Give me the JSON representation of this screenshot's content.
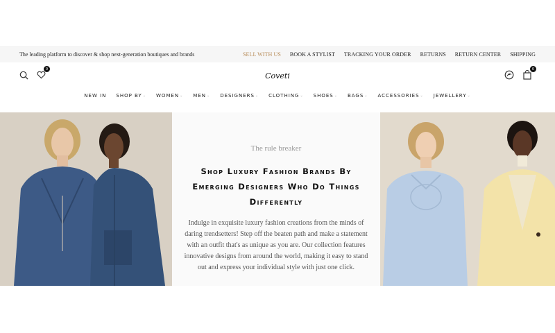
{
  "topbar": {
    "tagline": "The leading platform to discover & shop next-generation boutiques and brands",
    "links": [
      "SELL WITH US",
      "BOOK A STYLIST",
      "TRACKING YOUR ORDER",
      "RETURNS",
      "RETURN CENTER",
      "SHIPPING"
    ],
    "accent_color": "#b88d5a"
  },
  "header": {
    "logo_text": "Coveti",
    "wishlist_count": "0",
    "cart_count": "0",
    "icons": [
      "search-icon",
      "wishlist-heart-icon",
      "account-icon",
      "cart-bag-icon"
    ]
  },
  "nav": {
    "items": [
      "NEW IN",
      "SHOP BY",
      "WOMEN",
      "MEN",
      "DESIGNERS",
      "CLOTHING",
      "SHOES",
      "BAGS",
      "ACCESSORIES",
      "JEWELLERY"
    ]
  },
  "hero": {
    "overline": "The rule breaker",
    "headline": "Shop Luxury Fashion Brands By Emerging Designers Who Do Things Differently",
    "body": "Indulge in exquisite luxury fashion creations from the minds of daring trendsetters! Step off the beaten path and make a statement with an outfit that's as unique as you are. Our collection features innovative designs from around the world, making it easy to stand out and express your individual style with just one click."
  }
}
